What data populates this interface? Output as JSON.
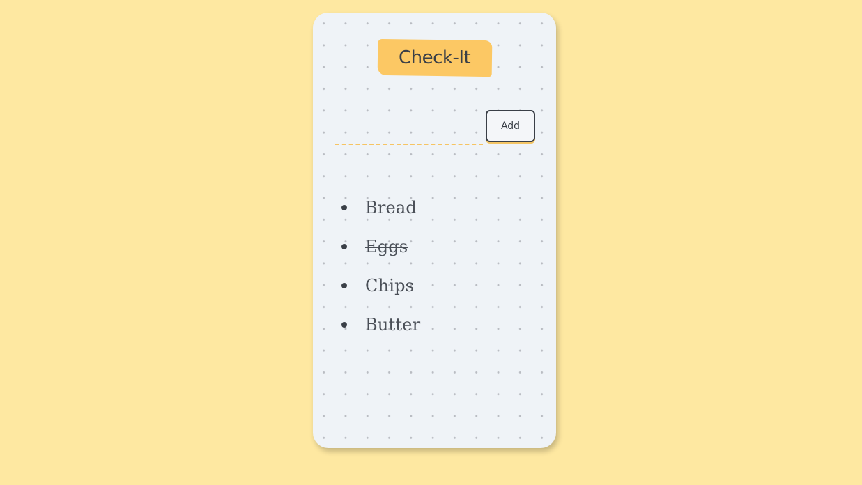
{
  "app": {
    "title": "Check-It"
  },
  "composer": {
    "input_value": "",
    "input_placeholder": "",
    "add_label": "Add"
  },
  "list": {
    "items": [
      {
        "label": "Bread",
        "done": false
      },
      {
        "label": "Eggs",
        "done": true
      },
      {
        "label": "Chips",
        "done": false
      },
      {
        "label": "Butter",
        "done": false
      }
    ]
  },
  "colors": {
    "background": "#fee8a1",
    "card": "#eff3f7",
    "accent": "#fcc864",
    "text": "#3a3f47"
  }
}
